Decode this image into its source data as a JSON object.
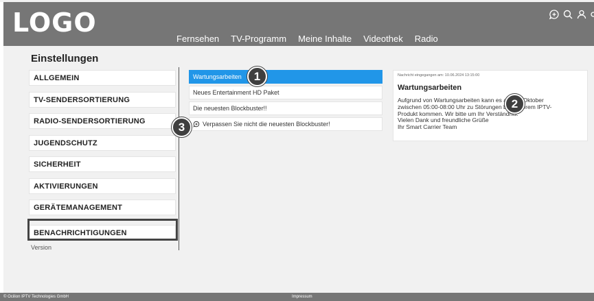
{
  "header": {
    "logo": "LOGO",
    "nav": [
      "Fernsehen",
      "TV-Programm",
      "Meine Inhalte",
      "Videothek",
      "Radio"
    ],
    "icons": [
      "message-plus-icon",
      "search-icon",
      "user-icon"
    ]
  },
  "page": {
    "title": "Einstellungen",
    "version": "Version"
  },
  "sidebar": {
    "items": [
      {
        "label": "ALLGEMEIN"
      },
      {
        "label": "TV-SENDERSORTIERUNG"
      },
      {
        "label": "RADIO-SENDERSORTIERUNG"
      },
      {
        "label": "JUGENDSCHUTZ"
      },
      {
        "label": "SICHERHEIT"
      },
      {
        "label": "AKTIVIERUNGEN"
      },
      {
        "label": "GERÄTEMANAGEMENT"
      },
      {
        "label": "BENACHRICHTIGUNGEN"
      }
    ],
    "selected": "BENACHRICHTIGUNGEN"
  },
  "messages": [
    {
      "label": "Wartungsarbeiten",
      "active": true
    },
    {
      "label": "Neues Entertainment HD Paket"
    },
    {
      "label": "Die neuesten Blockbuster!!"
    },
    {
      "label": "Verpassen Sie nicht die neuesten Blockbuster!",
      "icon": "message-plus-icon"
    }
  ],
  "detail": {
    "meta": "Nachricht eingegangen am: 10.06.2024 13:15:00",
    "title": "Wartungsarbeiten",
    "body": "Aufgrund von Wartungsarbeiten kann es am 14. Oktober\nzwischen 05:00-08:00 Uhr zu Störungen bei unserem IPTV-\nProdukt kommen. Wir bitte um Ihr Verständnis.\nVielen Dank und freundliche Grüße\nIhr Smart Carrier Team"
  },
  "badges": [
    "1",
    "2",
    "3"
  ],
  "footer": {
    "copyright": "© Ocilion IPTV Technologies GmbH",
    "impressum": "Impressum"
  },
  "colors": {
    "header": "#767676",
    "active": "#2196e8",
    "badge": "#3f3f3f"
  }
}
